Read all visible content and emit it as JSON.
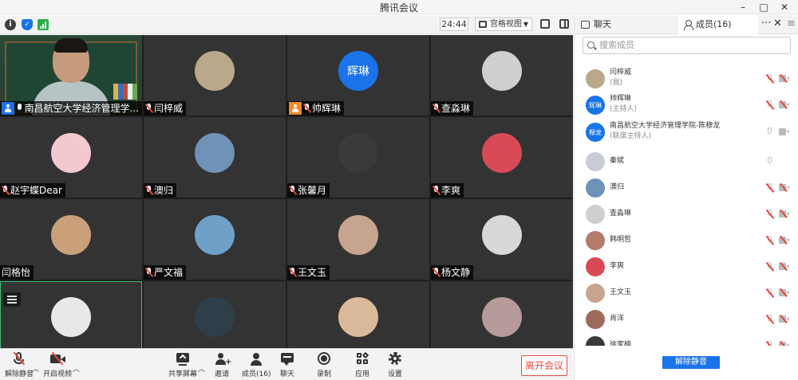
{
  "window": {
    "title": "腾讯会议",
    "minimize": "–",
    "maximize": "□",
    "close": "✕"
  },
  "top_toolbar": {
    "timer": "24:44",
    "view_label": "宫格视图"
  },
  "tiles": [
    {
      "name": "南昌航空大学经济管理学...",
      "badge": "host-blue",
      "mic": "on",
      "type": "camera"
    },
    {
      "name": "闫梓威",
      "mic": "muted",
      "avatar_color": "#b9a98a"
    },
    {
      "name": "帅辉琳",
      "badge": "host-orange",
      "mic": "muted",
      "avatar_text": "辉琳",
      "avatar_color": "#1a73e8"
    },
    {
      "name": "查淼琳",
      "mic": "muted",
      "avatar_color": "#cfcfcf"
    },
    {
      "name": "赵宇蝶Dear",
      "mic": "muted",
      "avatar_color": "#f4c8cf"
    },
    {
      "name": "澳归",
      "mic": "muted",
      "avatar_color": "#6f93b8"
    },
    {
      "name": "张馨月",
      "mic": "muted",
      "avatar_color": "#3a3a3a"
    },
    {
      "name": "李爽",
      "mic": "muted",
      "avatar_color": "#d94a57"
    },
    {
      "name": "闫格怡",
      "mic": "none",
      "avatar_color": "#c9a07a"
    },
    {
      "name": "严文福",
      "mic": "muted",
      "avatar_color": "#6fa0c8"
    },
    {
      "name": "王文玉",
      "mic": "muted",
      "avatar_color": "#c7a48f"
    },
    {
      "name": "杨文静",
      "mic": "muted",
      "avatar_color": "#d8d8d8"
    },
    {
      "name": "",
      "mic": "none",
      "avatar_color": "#e8e8e8"
    },
    {
      "name": "",
      "mic": "none",
      "avatar_color": "#2f3f4a"
    },
    {
      "name": "",
      "mic": "none",
      "avatar_color": "#d9b99a"
    },
    {
      "name": "",
      "mic": "none",
      "avatar_color": "#b79a9a"
    }
  ],
  "bottom_toolbar": {
    "unmute": "解除静音",
    "start_video": "开启视频",
    "share_screen": "共享屏幕",
    "invite": "邀请",
    "members": "成员(16)",
    "chat": "聊天",
    "record": "录制",
    "apps": "应用",
    "settings": "设置",
    "leave": "离开会议"
  },
  "right_panel": {
    "tab_chat": "聊天",
    "tab_members": "成员(16)",
    "more": "···",
    "close": "✕",
    "menu": "≡",
    "search_placeholder": "搜索成员",
    "members": [
      {
        "name": "闫梓威",
        "role": "(我)",
        "avatar_color": "#b9a98a",
        "mic": "muted",
        "cam": "off"
      },
      {
        "name": "帅辉琳",
        "role": "(主持人)",
        "avatar_text": "辉琳",
        "avatar_color": "#1a73e8",
        "mic": "muted",
        "cam": "off"
      },
      {
        "name": "南昌航空大学经济管理学院-陈穆龙",
        "role": "(联席主持人)",
        "avatar_text": "穆龙",
        "avatar_color": "#1a73e8",
        "mic": "on",
        "cam": "on"
      },
      {
        "name": "秦斌",
        "role": "",
        "avatar_color": "#c9ccd6",
        "mic": "on",
        "cam": "none"
      },
      {
        "name": "澳归",
        "role": "",
        "avatar_color": "#6f93b8",
        "mic": "muted",
        "cam": "off"
      },
      {
        "name": "查淼琳",
        "role": "",
        "avatar_color": "#cfcfcf",
        "mic": "muted",
        "cam": "off"
      },
      {
        "name": "韩明哲",
        "role": "",
        "avatar_color": "#b47a6a",
        "mic": "muted",
        "cam": "off"
      },
      {
        "name": "李爽",
        "role": "",
        "avatar_color": "#d94a57",
        "mic": "muted",
        "cam": "off"
      },
      {
        "name": "王文玉",
        "role": "",
        "avatar_color": "#c7a48f",
        "mic": "muted",
        "cam": "off"
      },
      {
        "name": "肖洋",
        "role": "",
        "avatar_color": "#9b6a5a",
        "mic": "muted",
        "cam": "off"
      },
      {
        "name": "徐家楠",
        "role": "",
        "avatar_color": "#3a3a3a",
        "mic": "muted",
        "cam": "off"
      }
    ],
    "unmute_all": "解除静音"
  }
}
